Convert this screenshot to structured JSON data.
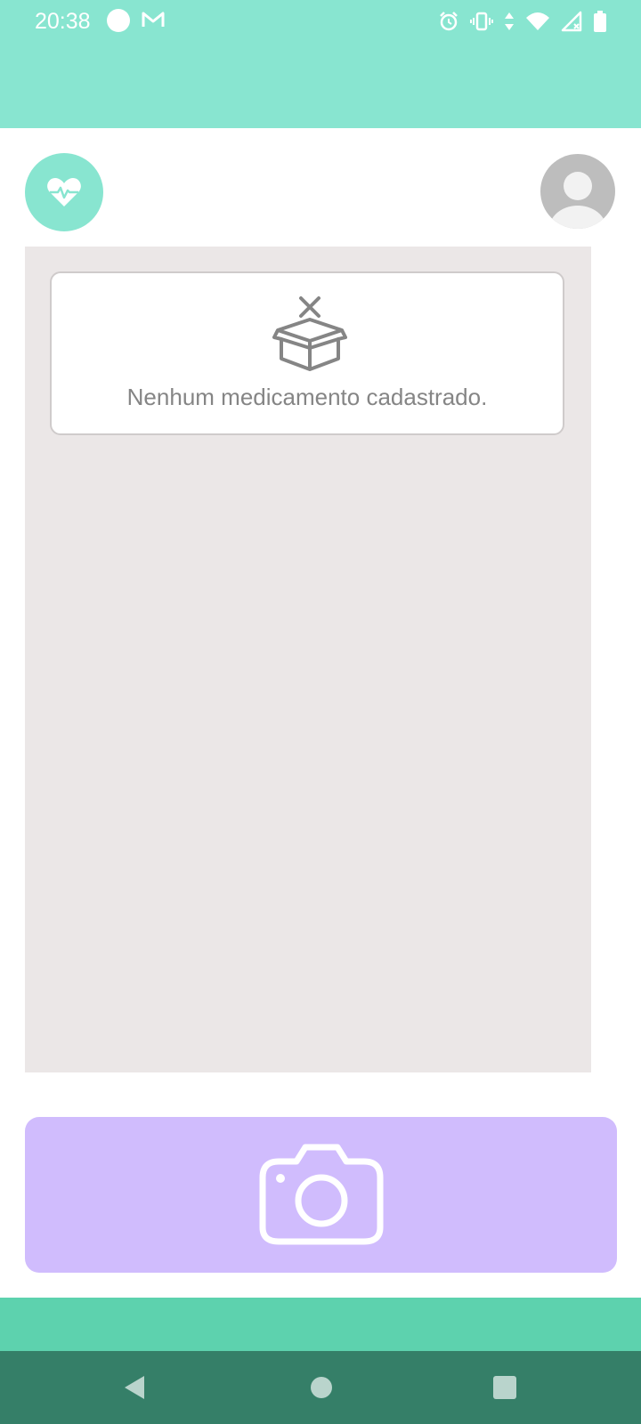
{
  "status_bar": {
    "time": "20:38",
    "icons": [
      "notification-dot-icon",
      "gmail-icon",
      "alarm-icon",
      "vibrate-icon",
      "data-arrows-icon",
      "wifi-icon",
      "signal-icon",
      "battery-icon"
    ],
    "color": "#88e5d0"
  },
  "header": {
    "logo_icon": "heart-pulse-icon",
    "avatar_icon": "user-avatar-icon"
  },
  "medication_list": {
    "empty_icon": "empty-box-icon",
    "empty_message": "Nenhum medicamento cadastrado."
  },
  "camera_button": {
    "icon": "camera-icon",
    "color": "#d0bcfd"
  },
  "nav_bar": {
    "buttons": [
      "back-icon",
      "home-icon",
      "recents-icon"
    ],
    "color": "#357f68"
  },
  "colors": {
    "accent": "#88e5d0",
    "panel": "#ebe7e7",
    "bottom_band": "#5dd2ae"
  }
}
